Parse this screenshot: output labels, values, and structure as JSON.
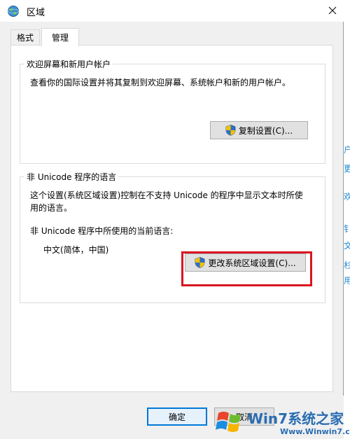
{
  "window": {
    "title": "区域",
    "close_glyph": "✕"
  },
  "tabs": [
    {
      "label": "格式",
      "active": false
    },
    {
      "label": "管理",
      "active": true
    }
  ],
  "welcome_group": {
    "title": "欢迎屏幕和新用户帐户",
    "description": "查看你的国际设置并将其复制到欢迎屏幕、系统帐户和新的用户帐户。",
    "copy_button": "复制设置(C)..."
  },
  "unicode_group": {
    "title": "非 Unicode 程序的语言",
    "description_line1": "这个设置(系统区域设置)控制在不支持 Unicode 的程序中显示文本时所使",
    "description_line2": "用的语言。",
    "current_label": "非 Unicode 程序中所使用的当前语言:",
    "current_value": "中文(简体，中国)",
    "change_button": "更改系统区域设置(C)..."
  },
  "footer": {
    "ok_button": "确定",
    "cancel_button": "取消"
  },
  "background_glyphs": [
    "户",
    "更",
    "欢",
    "钅",
    "文",
    "杉",
    "用"
  ],
  "watermark": {
    "brand": "Win7系统之家",
    "url": "Www.Winwin7.com"
  },
  "colors": {
    "accent": "#0078d7",
    "highlight": "#d9141f",
    "window_bg": "#f0f0f0"
  }
}
